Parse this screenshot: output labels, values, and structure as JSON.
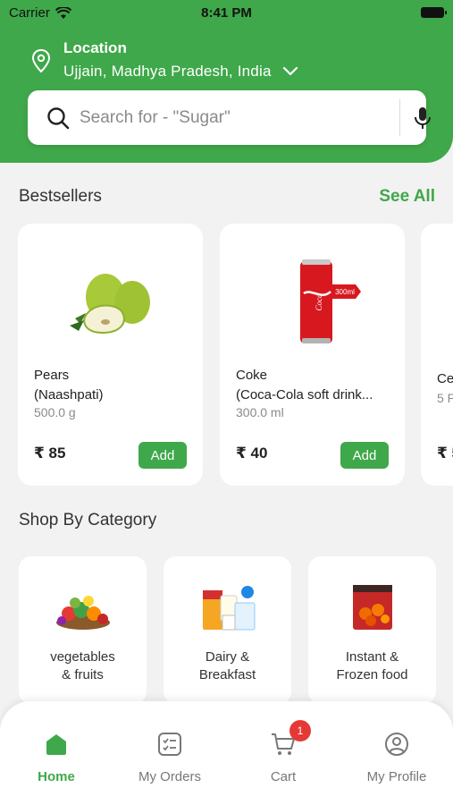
{
  "status_bar": {
    "carrier": "Carrier",
    "time": "8:41 PM"
  },
  "location": {
    "title": "Location",
    "value": "Ujjain, Madhya Pradesh, India"
  },
  "search": {
    "placeholder": "Search for - \"Sugar\""
  },
  "bestsellers": {
    "title": "Bestsellers",
    "see_all": "See All",
    "products": [
      {
        "name_line1": "Pears",
        "name_line2": "(Naashpati)",
        "qty": "500.0 g",
        "price": "₹ 85",
        "add_label": "Add",
        "icon": "pear-image"
      },
      {
        "name_line1": "Coke",
        "name_line2": "(Coca-Cola soft drink...",
        "qty": "300.0 ml",
        "price": "₹ 40",
        "add_label": "Add",
        "icon": "coke-can-image"
      }
    ],
    "partial": {
      "name": "Ce",
      "qty": "5 P",
      "price": "₹ 5"
    }
  },
  "categories": {
    "title": "Shop By Category",
    "items": [
      {
        "label": "vegetables\n& fruits",
        "icon": "vegetable-basket-image"
      },
      {
        "label": "Dairy &\nBreakfast",
        "icon": "dairy-products-image"
      },
      {
        "label": "Instant &\nFrozen food",
        "icon": "frozen-food-image"
      }
    ]
  },
  "tabbar": {
    "items": [
      {
        "label": "Home",
        "icon": "home-icon",
        "active": true
      },
      {
        "label": "My Orders",
        "icon": "orders-icon"
      },
      {
        "label": "Cart",
        "icon": "cart-icon",
        "badge": "1"
      },
      {
        "label": "My Profile",
        "icon": "profile-icon"
      }
    ]
  },
  "colors": {
    "brand_green": "#3fa84a",
    "badge_red": "#e53935",
    "background": "#f2f2f2"
  }
}
